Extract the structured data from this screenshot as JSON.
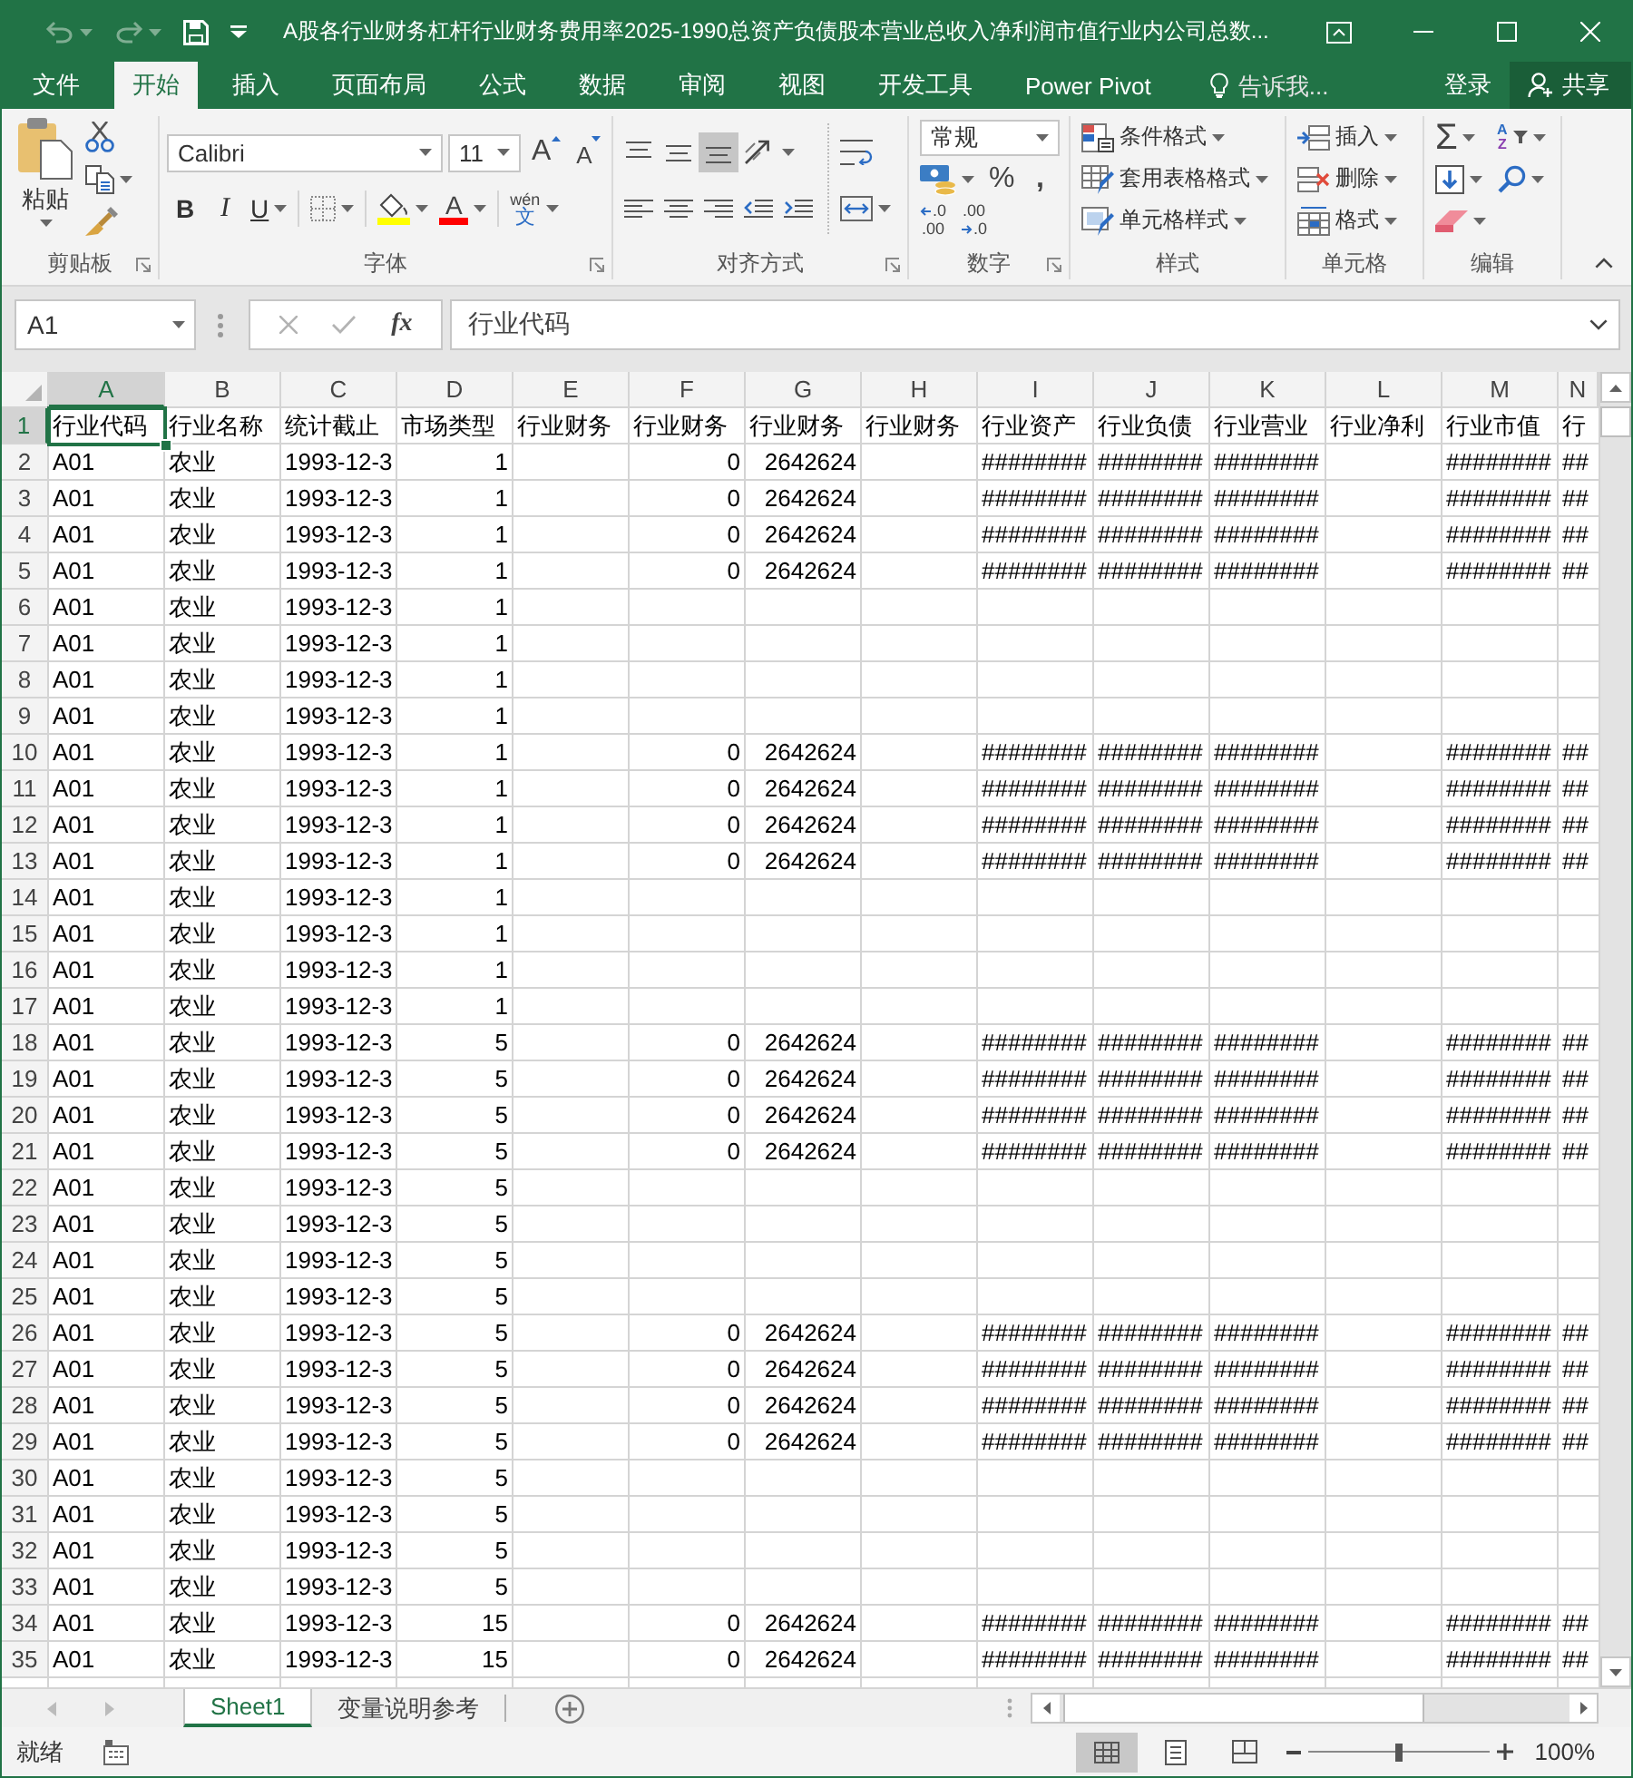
{
  "title_bar": {
    "quick_access": [
      {
        "kind": "undo",
        "disabled": true
      },
      {
        "kind": "redo",
        "disabled": true
      },
      {
        "kind": "save",
        "disabled": false
      },
      {
        "kind": "customize",
        "disabled": false
      }
    ],
    "title": "A股各行业财务杠杆行业财务费用率2025-1990总资产负债股本营业总收入净利润市值行业内公司总数..."
  },
  "ribbon_tabs": [
    {
      "label": "文件",
      "selected": false
    },
    {
      "label": "开始",
      "selected": true
    },
    {
      "label": "插入",
      "selected": false
    },
    {
      "label": "页面布局",
      "selected": false
    },
    {
      "label": "公式",
      "selected": false
    },
    {
      "label": "数据",
      "selected": false
    },
    {
      "label": "审阅",
      "selected": false
    },
    {
      "label": "视图",
      "selected": false
    },
    {
      "label": "开发工具",
      "selected": false
    },
    {
      "label": "Power Pivot",
      "selected": false
    }
  ],
  "tell_me": {
    "placeholder": "告诉我..."
  },
  "account": {
    "sign_in": "登录",
    "share": "共享"
  },
  "ribbon_groups": [
    {
      "kind": "clipboard",
      "label": "剪贴板",
      "launcher": true,
      "paste": "粘贴"
    },
    {
      "kind": "font",
      "label": "字体",
      "launcher": true,
      "font_name": "Calibri",
      "font_size": "11",
      "grow": "A",
      "shrink": "A",
      "bold": "B",
      "italic": "I",
      "underline": "U",
      "font_color": "A",
      "phonetic": [
        "wén",
        "文"
      ]
    },
    {
      "kind": "alignment",
      "label": "对齐方式",
      "launcher": true,
      "vertical": [
        {
          "kind": "top",
          "selected": false
        },
        {
          "kind": "middle",
          "selected": false
        },
        {
          "kind": "bottom",
          "selected": true
        }
      ],
      "horizontal": [
        {
          "kind": "left",
          "selected": false
        },
        {
          "kind": "center",
          "selected": false
        },
        {
          "kind": "right",
          "selected": false
        }
      ]
    },
    {
      "kind": "number",
      "label": "数字",
      "launcher": true,
      "format": "常规",
      "percent": "%",
      "comma": ",",
      "increase_decimal": [
        ".0",
        ".00"
      ],
      "decrease_decimal": [
        ".00",
        ".0"
      ]
    },
    {
      "kind": "styles",
      "label": "样式",
      "launcher": false,
      "buttons": [
        {
          "kind": "conditional",
          "label": "条件格式"
        },
        {
          "kind": "table",
          "label": "套用表格格式"
        },
        {
          "kind": "cell",
          "label": "单元格样式"
        }
      ]
    },
    {
      "kind": "cells",
      "label": "单元格",
      "launcher": false,
      "buttons": [
        {
          "kind": "insert",
          "label": "插入"
        },
        {
          "kind": "delete",
          "label": "删除"
        },
        {
          "kind": "format",
          "label": "格式"
        }
      ]
    },
    {
      "kind": "editing",
      "label": "编辑",
      "launcher": false,
      "sum": "Σ",
      "sort": [
        "A",
        "Z"
      ]
    }
  ],
  "formula_bar": {
    "name_box": "A1",
    "buttons": [
      {
        "kind": "cancel",
        "disabled": true
      },
      {
        "kind": "enter",
        "disabled": true
      }
    ],
    "function_label": "fx",
    "formula": "行业代码"
  },
  "sheet": {
    "columns": [
      {
        "label": "A",
        "selected": true
      },
      {
        "label": "B",
        "selected": false
      },
      {
        "label": "C",
        "selected": false
      },
      {
        "label": "D",
        "selected": false
      },
      {
        "label": "E",
        "selected": false
      },
      {
        "label": "F",
        "selected": false
      },
      {
        "label": "G",
        "selected": false
      },
      {
        "label": "H",
        "selected": false
      },
      {
        "label": "I",
        "selected": false
      },
      {
        "label": "J",
        "selected": false
      },
      {
        "label": "K",
        "selected": false
      },
      {
        "label": "L",
        "selected": false
      },
      {
        "label": "M",
        "selected": false
      },
      {
        "label": "N",
        "selected": false
      }
    ],
    "rows": [
      {
        "label": "1",
        "selected": true,
        "cells": [
          "行业代码",
          "行业名称",
          "统计截止",
          "市场类型",
          "行业财务",
          "行业财务",
          "行业财务",
          "行业财务",
          "行业资产",
          "行业负债",
          "行业营业",
          "行业净利",
          "行业市值",
          "行"
        ]
      },
      {
        "label": "2",
        "selected": false,
        "cells": [
          "A01",
          "农业",
          "1993-12-3",
          "1",
          null,
          "0",
          "2642624",
          null,
          "########",
          "########",
          "########",
          null,
          "########",
          "##"
        ]
      },
      {
        "label": "3",
        "selected": false,
        "cells": [
          "A01",
          "农业",
          "1993-12-3",
          "1",
          null,
          "0",
          "2642624",
          null,
          "########",
          "########",
          "########",
          null,
          "########",
          "##"
        ]
      },
      {
        "label": "4",
        "selected": false,
        "cells": [
          "A01",
          "农业",
          "1993-12-3",
          "1",
          null,
          "0",
          "2642624",
          null,
          "########",
          "########",
          "########",
          null,
          "########",
          "##"
        ]
      },
      {
        "label": "5",
        "selected": false,
        "cells": [
          "A01",
          "农业",
          "1993-12-3",
          "1",
          null,
          "0",
          "2642624",
          null,
          "########",
          "########",
          "########",
          null,
          "########",
          "##"
        ]
      },
      {
        "label": "6",
        "selected": false,
        "cells": [
          "A01",
          "农业",
          "1993-12-3",
          "1"
        ]
      },
      {
        "label": "7",
        "selected": false,
        "cells": [
          "A01",
          "农业",
          "1993-12-3",
          "1"
        ]
      },
      {
        "label": "8",
        "selected": false,
        "cells": [
          "A01",
          "农业",
          "1993-12-3",
          "1"
        ]
      },
      {
        "label": "9",
        "selected": false,
        "cells": [
          "A01",
          "农业",
          "1993-12-3",
          "1"
        ]
      },
      {
        "label": "10",
        "selected": false,
        "cells": [
          "A01",
          "农业",
          "1993-12-3",
          "1",
          null,
          "0",
          "2642624",
          null,
          "########",
          "########",
          "########",
          null,
          "########",
          "##"
        ]
      },
      {
        "label": "11",
        "selected": false,
        "cells": [
          "A01",
          "农业",
          "1993-12-3",
          "1",
          null,
          "0",
          "2642624",
          null,
          "########",
          "########",
          "########",
          null,
          "########",
          "##"
        ]
      },
      {
        "label": "12",
        "selected": false,
        "cells": [
          "A01",
          "农业",
          "1993-12-3",
          "1",
          null,
          "0",
          "2642624",
          null,
          "########",
          "########",
          "########",
          null,
          "########",
          "##"
        ]
      },
      {
        "label": "13",
        "selected": false,
        "cells": [
          "A01",
          "农业",
          "1993-12-3",
          "1",
          null,
          "0",
          "2642624",
          null,
          "########",
          "########",
          "########",
          null,
          "########",
          "##"
        ]
      },
      {
        "label": "14",
        "selected": false,
        "cells": [
          "A01",
          "农业",
          "1993-12-3",
          "1"
        ]
      },
      {
        "label": "15",
        "selected": false,
        "cells": [
          "A01",
          "农业",
          "1993-12-3",
          "1"
        ]
      },
      {
        "label": "16",
        "selected": false,
        "cells": [
          "A01",
          "农业",
          "1993-12-3",
          "1"
        ]
      },
      {
        "label": "17",
        "selected": false,
        "cells": [
          "A01",
          "农业",
          "1993-12-3",
          "1"
        ]
      },
      {
        "label": "18",
        "selected": false,
        "cells": [
          "A01",
          "农业",
          "1993-12-3",
          "5",
          null,
          "0",
          "2642624",
          null,
          "########",
          "########",
          "########",
          null,
          "########",
          "##"
        ]
      },
      {
        "label": "19",
        "selected": false,
        "cells": [
          "A01",
          "农业",
          "1993-12-3",
          "5",
          null,
          "0",
          "2642624",
          null,
          "########",
          "########",
          "########",
          null,
          "########",
          "##"
        ]
      },
      {
        "label": "20",
        "selected": false,
        "cells": [
          "A01",
          "农业",
          "1993-12-3",
          "5",
          null,
          "0",
          "2642624",
          null,
          "########",
          "########",
          "########",
          null,
          "########",
          "##"
        ]
      },
      {
        "label": "21",
        "selected": false,
        "cells": [
          "A01",
          "农业",
          "1993-12-3",
          "5",
          null,
          "0",
          "2642624",
          null,
          "########",
          "########",
          "########",
          null,
          "########",
          "##"
        ]
      },
      {
        "label": "22",
        "selected": false,
        "cells": [
          "A01",
          "农业",
          "1993-12-3",
          "5"
        ]
      },
      {
        "label": "23",
        "selected": false,
        "cells": [
          "A01",
          "农业",
          "1993-12-3",
          "5"
        ]
      },
      {
        "label": "24",
        "selected": false,
        "cells": [
          "A01",
          "农业",
          "1993-12-3",
          "5"
        ]
      },
      {
        "label": "25",
        "selected": false,
        "cells": [
          "A01",
          "农业",
          "1993-12-3",
          "5"
        ]
      },
      {
        "label": "26",
        "selected": false,
        "cells": [
          "A01",
          "农业",
          "1993-12-3",
          "5",
          null,
          "0",
          "2642624",
          null,
          "########",
          "########",
          "########",
          null,
          "########",
          "##"
        ]
      },
      {
        "label": "27",
        "selected": false,
        "cells": [
          "A01",
          "农业",
          "1993-12-3",
          "5",
          null,
          "0",
          "2642624",
          null,
          "########",
          "########",
          "########",
          null,
          "########",
          "##"
        ]
      },
      {
        "label": "28",
        "selected": false,
        "cells": [
          "A01",
          "农业",
          "1993-12-3",
          "5",
          null,
          "0",
          "2642624",
          null,
          "########",
          "########",
          "########",
          null,
          "########",
          "##"
        ]
      },
      {
        "label": "29",
        "selected": false,
        "cells": [
          "A01",
          "农业",
          "1993-12-3",
          "5",
          null,
          "0",
          "2642624",
          null,
          "########",
          "########",
          "########",
          null,
          "########",
          "##"
        ]
      },
      {
        "label": "30",
        "selected": false,
        "cells": [
          "A01",
          "农业",
          "1993-12-3",
          "5"
        ]
      },
      {
        "label": "31",
        "selected": false,
        "cells": [
          "A01",
          "农业",
          "1993-12-3",
          "5"
        ]
      },
      {
        "label": "32",
        "selected": false,
        "cells": [
          "A01",
          "农业",
          "1993-12-3",
          "5"
        ]
      },
      {
        "label": "33",
        "selected": false,
        "cells": [
          "A01",
          "农业",
          "1993-12-3",
          "5"
        ]
      },
      {
        "label": "34",
        "selected": false,
        "cells": [
          "A01",
          "农业",
          "1993-12-3",
          "15",
          null,
          "0",
          "2642624",
          null,
          "########",
          "########",
          "########",
          null,
          "########",
          "##"
        ]
      },
      {
        "label": "35",
        "selected": false,
        "cells": [
          "A01",
          "农业",
          "1993-12-3",
          "15",
          null,
          "0",
          "2642624",
          null,
          "########",
          "########",
          "########",
          null,
          "########",
          "##"
        ]
      }
    ]
  },
  "sheet_tabs": [
    {
      "label": "Sheet1",
      "selected": true
    },
    {
      "label": "变量说明参考",
      "selected": false
    }
  ],
  "status_bar": {
    "status": "就绪",
    "views": [
      {
        "kind": "normal",
        "selected": true
      },
      {
        "kind": "page_layout",
        "selected": false
      },
      {
        "kind": "page_break",
        "selected": false
      }
    ],
    "zoom": {
      "level": 0.5,
      "reading": "100%"
    }
  }
}
